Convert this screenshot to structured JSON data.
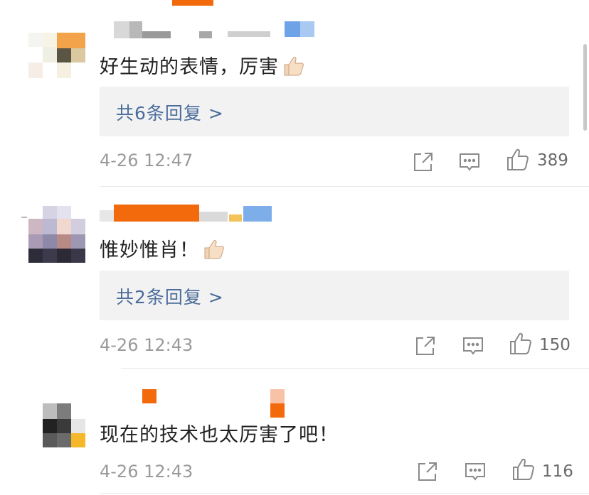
{
  "comments": [
    {
      "text": "好生动的表情，厉害",
      "emoji": "thumbs-up",
      "replies_label": "共6条回复 >",
      "time": "4-26 12:47",
      "likes": "389"
    },
    {
      "text": "惟妙惟肖！",
      "emoji": "thumbs-up",
      "replies_label": "共2条回复 >",
      "time": "4-26 12:43",
      "likes": "150"
    },
    {
      "text": "现在的技术也太厉害了吧！",
      "emoji": "",
      "replies_label": "",
      "time": "4-26 12:43",
      "likes": "116"
    }
  ],
  "colors": {
    "reply_link": "#4a6c9b",
    "reply_bg": "#f2f2f2",
    "meta_gray": "#9a9a9a",
    "redaction_orange": "#f26a0b"
  }
}
